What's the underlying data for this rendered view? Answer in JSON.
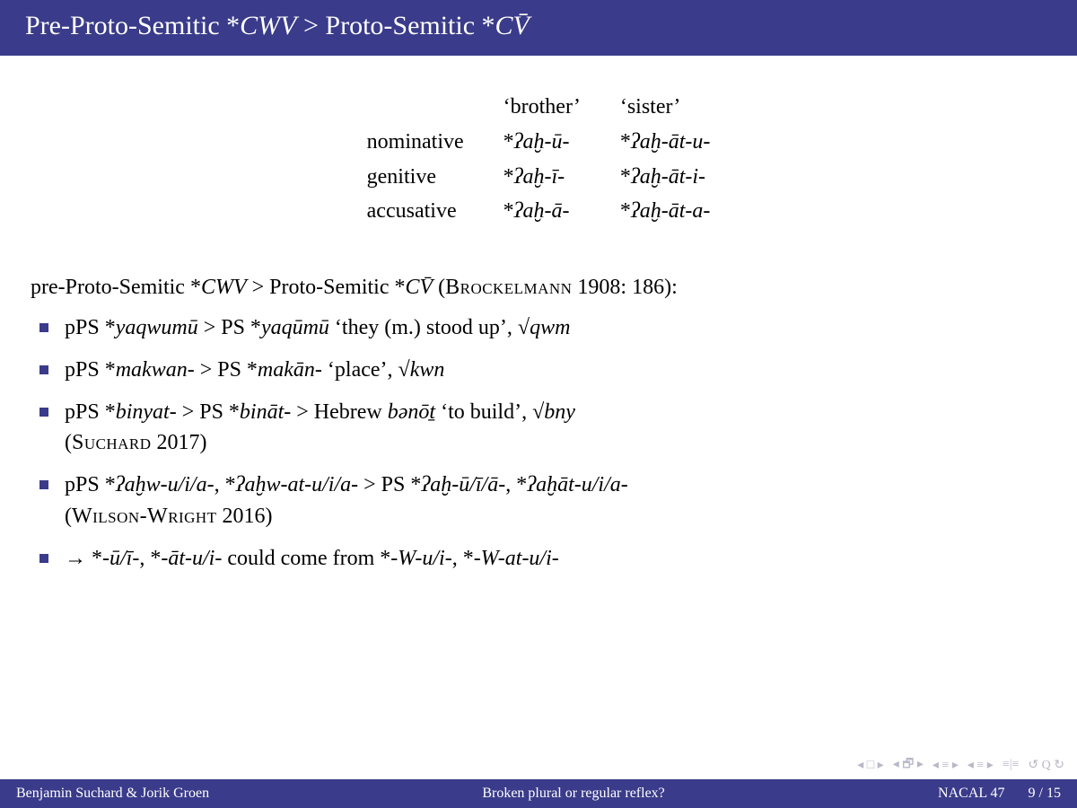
{
  "title_html": "Pre-Proto-Semitic *<span class='ital'>CWV</span> &gt; Proto-Semitic *<span class='ital'>CV̄</span>",
  "paradigm": {
    "col1": "‘brother’",
    "col2": "‘sister’",
    "rows": [
      {
        "label": "nominative",
        "c1_html": "*<span class='ital'>ʔaḫ-ū-</span>",
        "c2_html": "*<span class='ital'>ʔaḫ-āt-u-</span>"
      },
      {
        "label": "genitive",
        "c1_html": "*<span class='ital'>ʔaḫ-ī-</span>",
        "c2_html": "*<span class='ital'>ʔaḫ-āt-i-</span>"
      },
      {
        "label": "accusative",
        "c1_html": "*<span class='ital'>ʔaḫ-ā-</span>",
        "c2_html": "*<span class='ital'>ʔaḫ-āt-a-</span>"
      }
    ]
  },
  "lead_html": "pre-Proto-Semitic *<span class='ital'>CWV</span> &gt; Proto-Semitic *<span class='ital'>CV̄</span> (<span class='sc'>Brockelmann</span> 1908: 186):",
  "bullets": [
    "pPS *<span class='ital'>yaqwumū</span> &gt; PS *<span class='ital'>yaqūmū</span> ‘they (m.) stood up’, √<span class='ital'>qwm</span>",
    "pPS *<span class='ital'>makwan-</span> &gt; PS *<span class='ital'>makān-</span> ‘place’, √<span class='ital'>kwn</span>",
    "pPS *<span class='ital'>binyat-</span> &gt; PS *<span class='ital'>bināt-</span> &gt; Hebrew <span class='ital'>bənōṯ</span> ‘to build’, √<span class='ital'>bny</span><br>(<span class='sc'>Suchard</span> 2017)",
    "pPS *<span class='ital'>ʔaḫw-u/i/a-</span>, *<span class='ital'>ʔaḫw-at-u/i/a-</span> &gt; PS *<span class='ital'>ʔaḫ-ū/ī/ā-</span>, *<span class='ital'>ʔaḫāt-u/i/a-</span><br>(<span class='sc'>Wilson-Wright</span> 2016)",
    "→ *<span class='ital'>-ū/ī-</span>, *<span class='ital'>-āt-u/i-</span> could come from *<span class='ital'>-W-u/i-</span>, *<span class='ital'>-W-at-u/i-</span>"
  ],
  "nav": {
    "first": "◂ □ ▸",
    "prev": "◂ 🗗 ▸",
    "back": "◂ ≡ ▸",
    "fwd": "◂ ≡ ▸",
    "mode": "≡|≡",
    "loop": "↺ Q ↻"
  },
  "footer": {
    "authors": "Benjamin Suchard & Jorik Groen",
    "talk": "Broken plural or regular reflex?",
    "venue": "NACAL 47",
    "page": "9 / 15"
  }
}
